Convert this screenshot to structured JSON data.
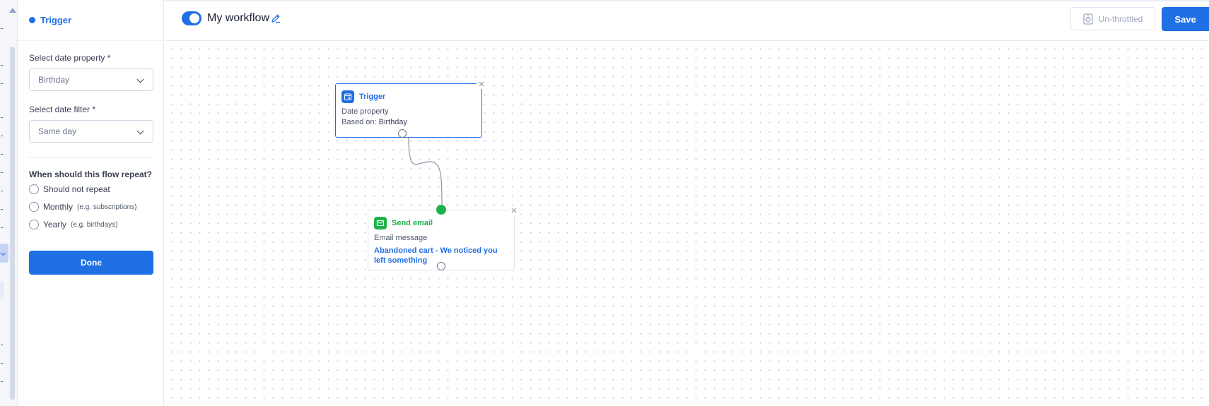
{
  "panel": {
    "title": "Trigger",
    "date_property_label": "Select date property *",
    "date_property_value": "Birthday",
    "date_filter_label": "Select date filter *",
    "date_filter_value": "Same day",
    "repeat_label": "When should this flow repeat?",
    "repeat_options": [
      {
        "label": "Should not repeat",
        "hint": ""
      },
      {
        "label": "Monthly",
        "hint": "(e.g. subscriptions)"
      },
      {
        "label": "Yearly",
        "hint": "(e.g. birthdays)"
      }
    ],
    "done_label": "Done"
  },
  "header": {
    "workflow_title": "My workflow",
    "throttle_label": "Un-throttled",
    "save_label": "Save"
  },
  "nodes": {
    "trigger": {
      "title": "Trigger",
      "line1": "Date property",
      "line2_prefix": "Based on:",
      "line2_value": "Birthday"
    },
    "email": {
      "title": "Send email",
      "line1": "Email message",
      "message": "Abandoned cart - We noticed you left something"
    }
  },
  "colors": {
    "accent": "#1f6fe5",
    "email_green": "#1db34a"
  },
  "icons": {
    "trigger": "calendar-trigger-icon",
    "email": "mail-icon",
    "edit": "pencil-icon",
    "throttle": "stopwatch-icon",
    "close": "close-icon"
  }
}
